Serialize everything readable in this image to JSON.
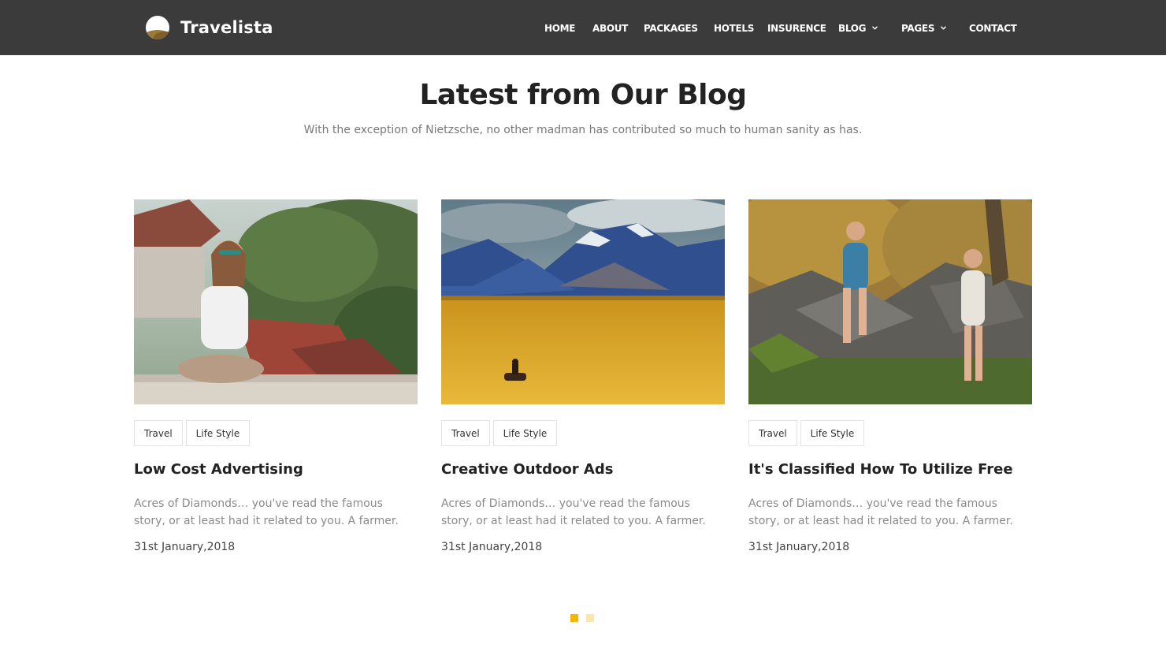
{
  "brand": {
    "name": "Travelista",
    "logo_icon": "travelista-logo-icon"
  },
  "nav": {
    "items": [
      {
        "label": "HOME"
      },
      {
        "label": "ABOUT"
      },
      {
        "label": "PACKAGES"
      },
      {
        "label": "HOTELS"
      },
      {
        "label": "INSURENCE"
      },
      {
        "label": "BLOG",
        "icon": "chevron-down-icon"
      },
      {
        "label": "PAGES",
        "icon": "chevron-down-icon"
      },
      {
        "label": "CONTACT"
      }
    ]
  },
  "section": {
    "title": "Latest from Our Blog",
    "subtitle": "With the exception of Nietzsche, no other madman has contributed so much to human sanity as has."
  },
  "posts": [
    {
      "image": "woman-sitting-on-rooftop-photo",
      "tags": [
        "Travel",
        "Life Style"
      ],
      "title": "Low Cost Advertising",
      "excerpt": "Acres of Diamonds… you've read the famous story, or at least had it related to you. A farmer.",
      "date": "31st January,2018"
    },
    {
      "image": "horse-rider-in-golden-field-photo",
      "tags": [
        "Travel",
        "Life Style"
      ],
      "title": "Creative Outdoor Ads",
      "excerpt": "Acres of Diamonds… you've read the famous story, or at least had it related to you. A farmer.",
      "date": "31st January,2018"
    },
    {
      "image": "two-women-hiking-rocks-photo",
      "tags": [
        "Travel",
        "Life Style"
      ],
      "title": "It's Classified How To Utilize Free",
      "excerpt": "Acres of Diamonds… you've read the famous story, or at least had it related to you. A farmer.",
      "date": "31st January,2018"
    }
  ],
  "carousel": {
    "pages": 2,
    "active_page": 1
  },
  "colors": {
    "navbar": "#3b3b3b",
    "accent": "#f6b500",
    "dot_inactive": "#fbe6b0"
  }
}
